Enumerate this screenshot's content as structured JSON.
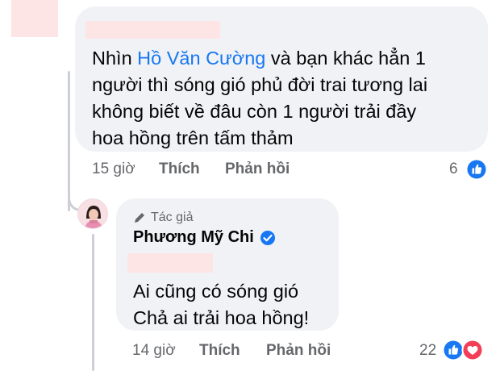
{
  "comment1": {
    "text_prefix": "Nhìn ",
    "mention": "Hồ Văn Cường",
    "text_rest": " và bạn khác hẳn 1\nngười thì sóng gió phủ đời trai tương lai\nkhông biết về đâu còn 1 người trải đầy\nhoa hồng trên tấm thảm",
    "time": "15 giờ",
    "like_label": "Thích",
    "reply_label": "Phản hồi",
    "reaction_count": "6"
  },
  "reply": {
    "badge": "Tác giả",
    "author": "Phương Mỹ Chi",
    "text": "Ai cũng có sóng gió\nChả ai trải hoa hồng!",
    "time": "14 giờ",
    "like_label": "Thích",
    "reply_label": "Phản hồi",
    "reaction_count": "22"
  },
  "colors": {
    "bubble": "#f0f2f5",
    "link": "#1877f2",
    "meta": "#65676b",
    "heart": "#f33e58",
    "redaction": "#fde5e6"
  },
  "icons": {
    "like": "like-icon",
    "love": "love-icon",
    "verified": "verified-badge-icon",
    "author": "pencil-icon"
  }
}
